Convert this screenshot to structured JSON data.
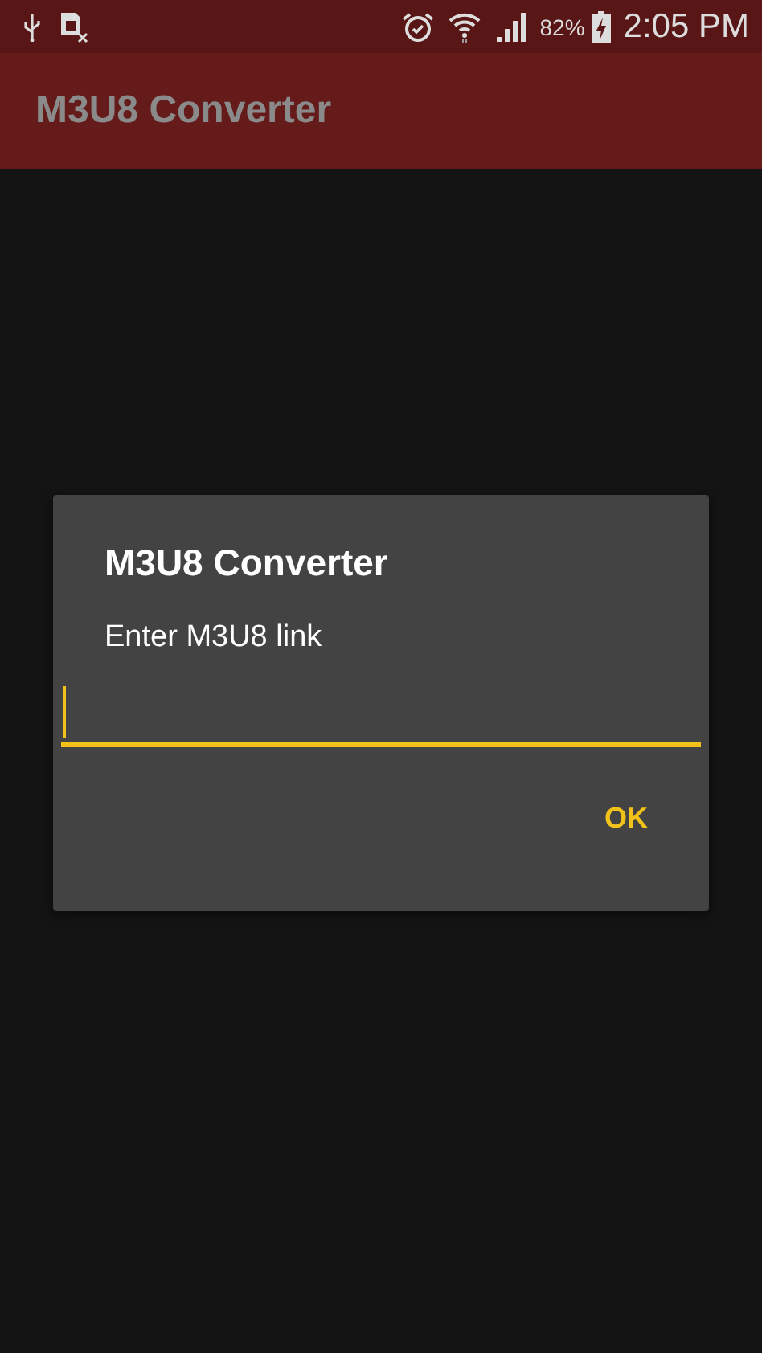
{
  "status_bar": {
    "battery": "82%",
    "time": "2:05 PM"
  },
  "app_bar": {
    "title": "M3U8 Converter"
  },
  "dialog": {
    "title": "M3U8 Converter",
    "message": "Enter M3U8 link",
    "input": {
      "focused": true
    },
    "buttons": [
      "OK"
    ]
  }
}
